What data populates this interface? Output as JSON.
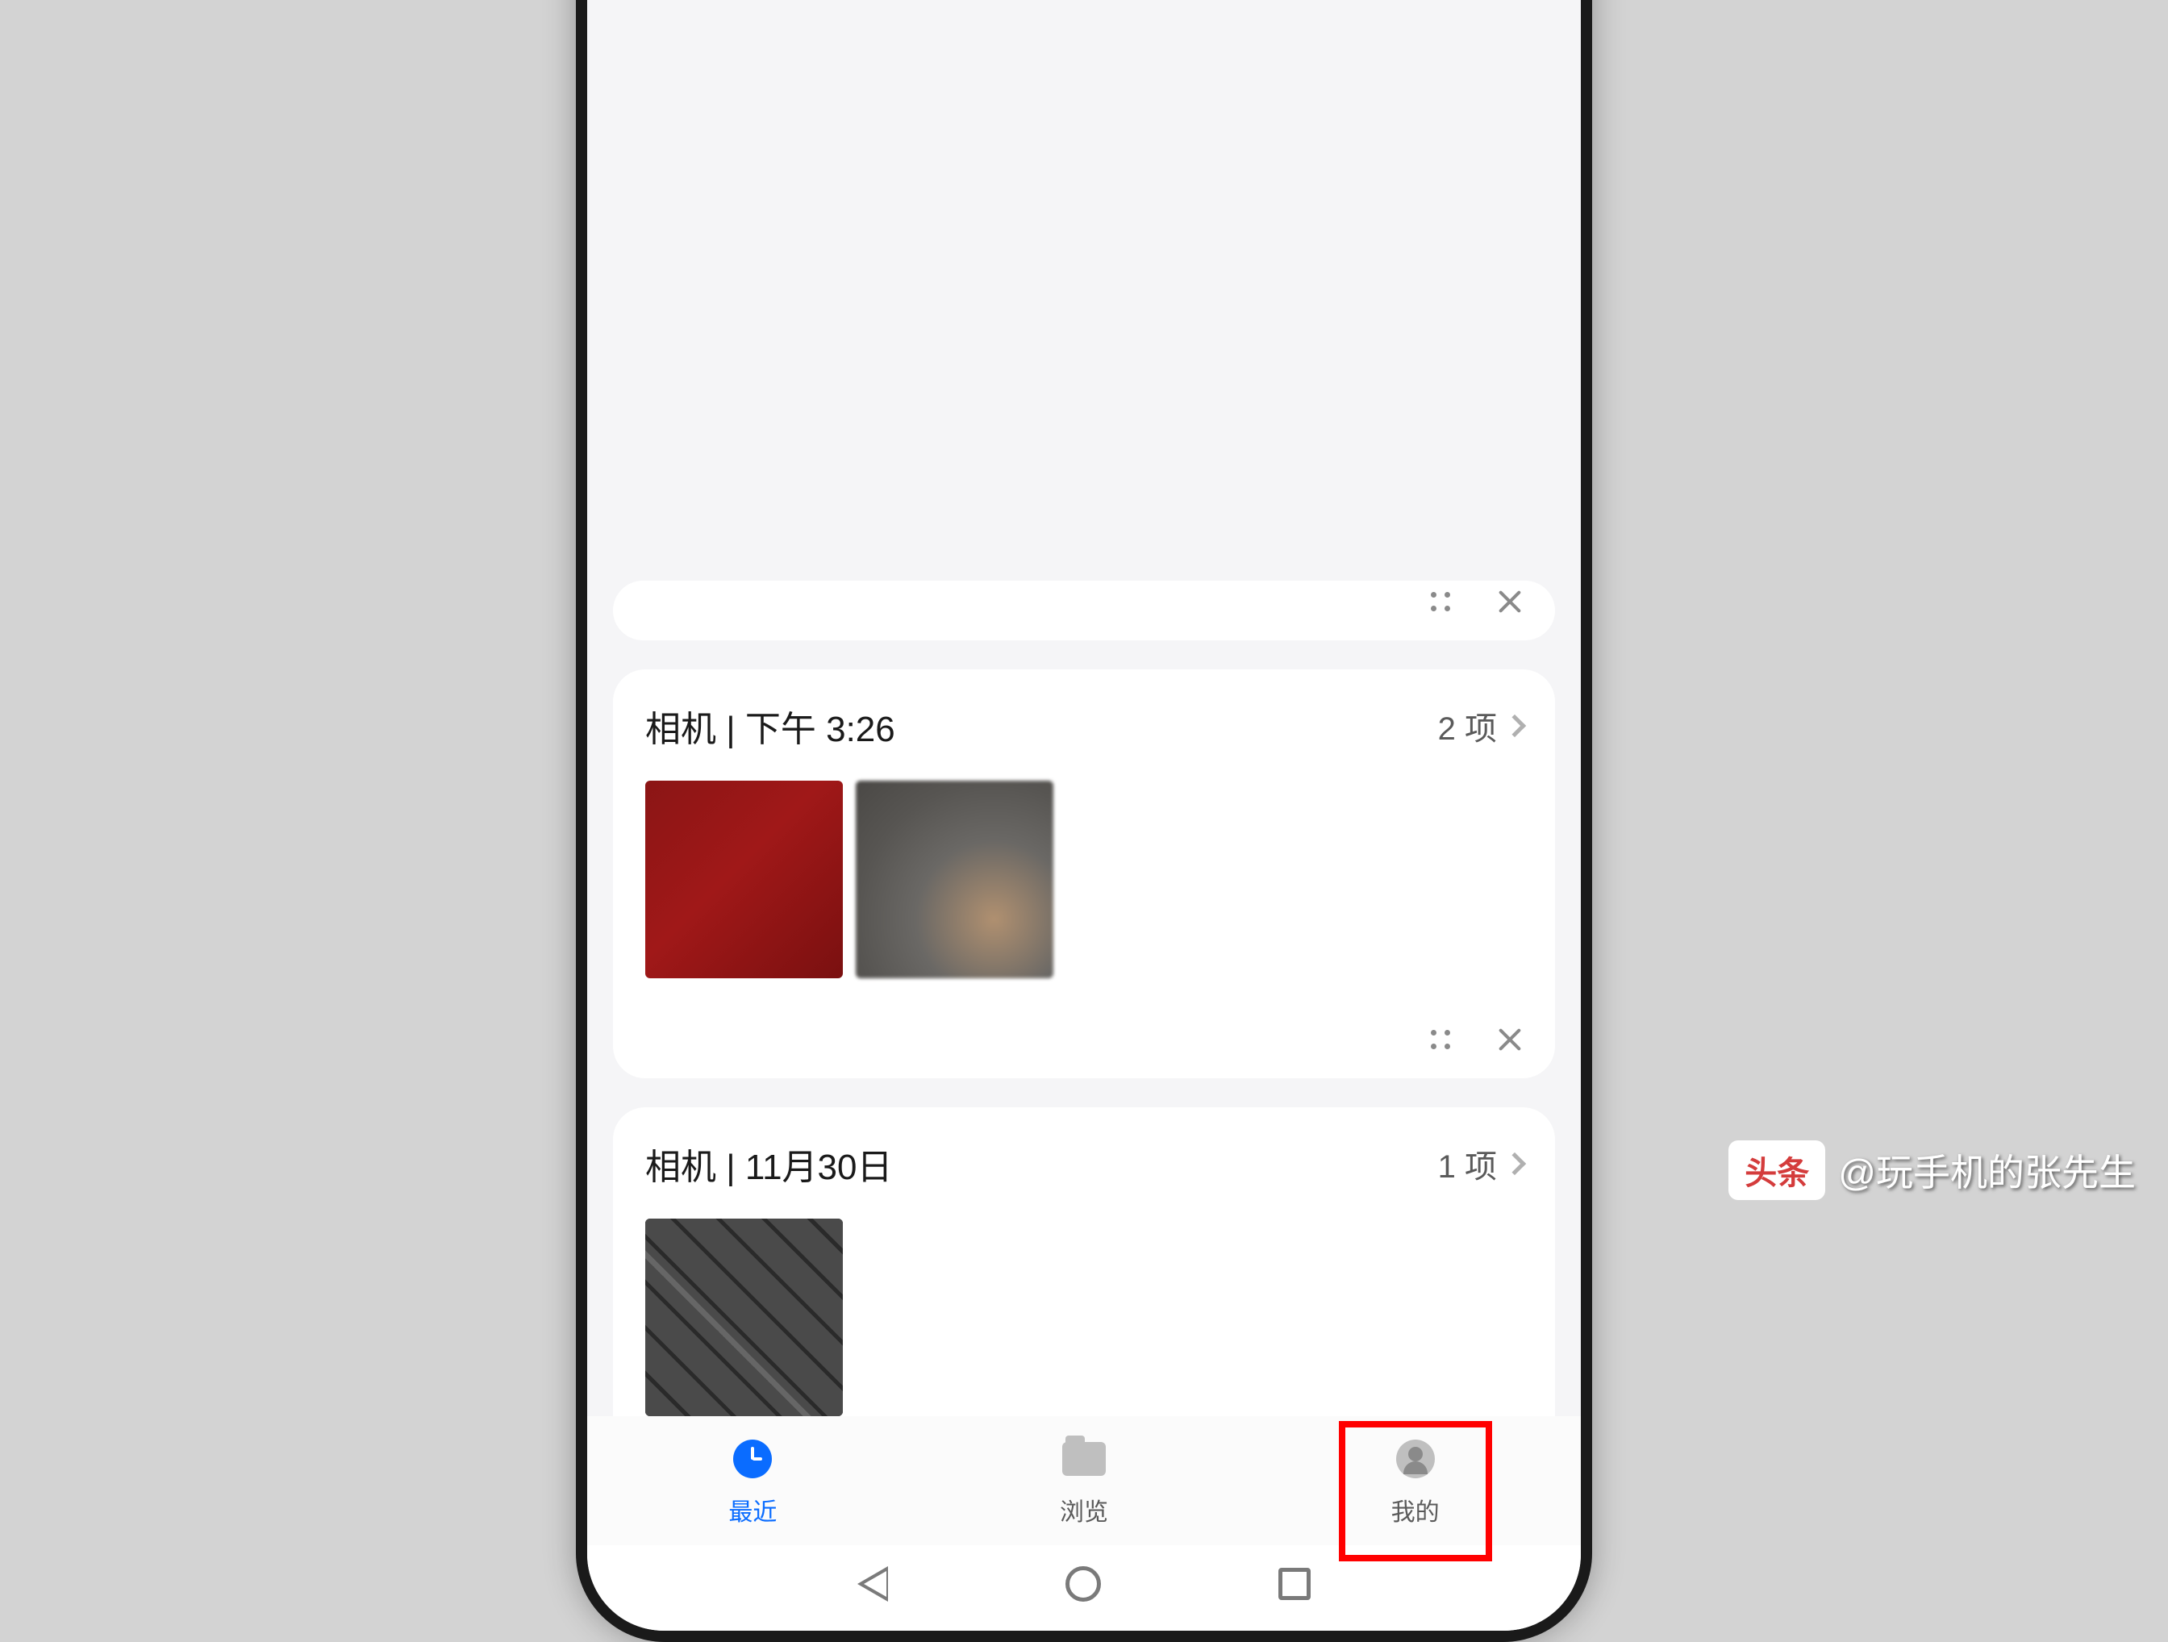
{
  "cards": {
    "card1": {
      "title": "相机 | 下午 3:26",
      "count": "2 项"
    },
    "card2": {
      "title": "相机 | 11月30日",
      "count": "1 项"
    }
  },
  "tabs": {
    "recent": "最近",
    "browse": "浏览",
    "mine": "我的"
  },
  "watermark": {
    "badge": "头条",
    "handle": "@玩手机的张先生"
  },
  "highlight": {
    "target": "tab-mine"
  }
}
